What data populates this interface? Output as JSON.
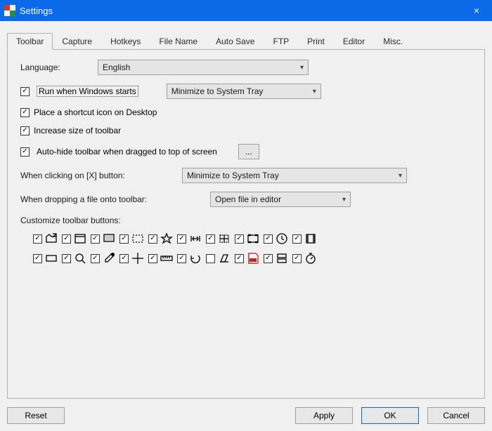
{
  "window": {
    "title": "Settings",
    "close_icon": "×"
  },
  "tabs": [
    {
      "label": "Toolbar",
      "active": true
    },
    {
      "label": "Capture",
      "active": false
    },
    {
      "label": "Hotkeys",
      "active": false
    },
    {
      "label": "File Name",
      "active": false
    },
    {
      "label": "Auto Save",
      "active": false
    },
    {
      "label": "FTP",
      "active": false
    },
    {
      "label": "Print",
      "active": false
    },
    {
      "label": "Editor",
      "active": false
    },
    {
      "label": "Misc.",
      "active": false
    }
  ],
  "panel": {
    "language_label": "Language:",
    "language_value": "English",
    "run_on_start": {
      "checked": true,
      "label": "Run when Windows starts"
    },
    "run_on_start_select": "Minimize to System Tray",
    "shortcut_desktop": {
      "checked": true,
      "label": "Place a shortcut icon on Desktop"
    },
    "increase_toolbar": {
      "checked": true,
      "label": "Increase size of toolbar"
    },
    "auto_hide": {
      "checked": true,
      "label": "Auto-hide toolbar when dragged to top of screen"
    },
    "ellipsis": "...",
    "close_action_label": "When clicking on [X] button:",
    "close_action_value": "Minimize to System Tray",
    "drop_file_label": "When dropping a file onto toolbar:",
    "drop_file_value": "Open file in editor",
    "customize_label": "Customize toolbar buttons:",
    "icons_row1": [
      {
        "checked": true,
        "name": "folder-arrow-icon"
      },
      {
        "checked": true,
        "name": "window-icon"
      },
      {
        "checked": true,
        "name": "monitor-icon"
      },
      {
        "checked": true,
        "name": "region-icon"
      },
      {
        "checked": true,
        "name": "star-icon"
      },
      {
        "checked": true,
        "name": "bracket-arrows-icon"
      },
      {
        "checked": true,
        "name": "grid-arrows-icon"
      },
      {
        "checked": true,
        "name": "frame-icon"
      },
      {
        "checked": true,
        "name": "clock-icon"
      },
      {
        "checked": true,
        "name": "film-icon"
      }
    ],
    "icons_row2": [
      {
        "checked": true,
        "name": "rect-icon"
      },
      {
        "checked": true,
        "name": "magnifier-icon"
      },
      {
        "checked": true,
        "name": "eyedropper-icon"
      },
      {
        "checked": true,
        "name": "crosshair-icon"
      },
      {
        "checked": true,
        "name": "ruler-icon"
      },
      {
        "checked": true,
        "name": "undo-icon"
      },
      {
        "checked": false,
        "name": "scanner-icon"
      },
      {
        "checked": true,
        "name": "pdf-icon"
      },
      {
        "checked": true,
        "name": "stacked-sheets-icon"
      },
      {
        "checked": true,
        "name": "stopwatch-icon"
      }
    ]
  },
  "footer": {
    "reset": "Reset",
    "apply": "Apply",
    "ok": "OK",
    "cancel": "Cancel"
  }
}
